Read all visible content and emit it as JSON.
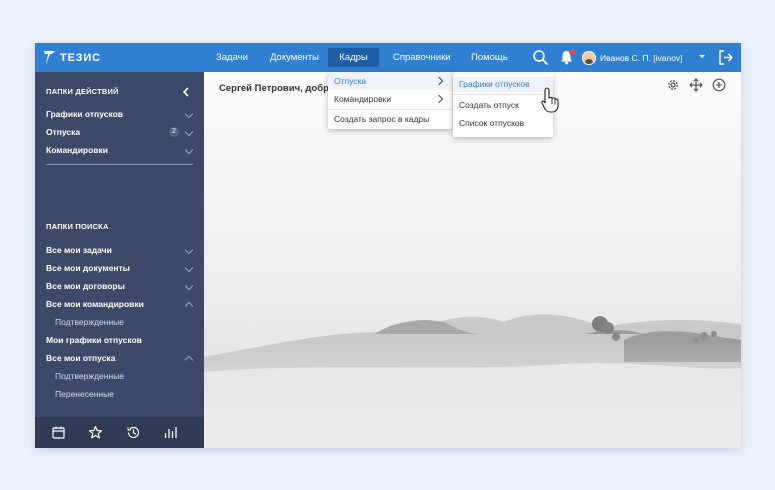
{
  "app": {
    "logo_text": "ТЕЗИС"
  },
  "nav": {
    "items": [
      {
        "label": "Задачи"
      },
      {
        "label": "Документы"
      },
      {
        "label": "Кадры",
        "active": true
      },
      {
        "label": "Справочники"
      },
      {
        "label": "Помощь"
      }
    ]
  },
  "user": {
    "name": "Иванов С. П. [ivanov]"
  },
  "sidebar": {
    "actions_heading": "ПАПКИ ДЕЙСТВИЙ",
    "action_items": [
      {
        "label": "Графики отпусков"
      },
      {
        "label": "Отпуска",
        "count": "2"
      },
      {
        "label": "Командировки"
      }
    ],
    "search_heading": "ПАПКИ ПОИСКА",
    "search_items": [
      {
        "label": "Все мои задачи"
      },
      {
        "label": "Все мои документы"
      },
      {
        "label": "Все мои договоры"
      },
      {
        "label": "Все мои командировки"
      },
      {
        "label": "Подтвержденные"
      },
      {
        "label": "Мои графики отпусков"
      },
      {
        "label": "Все мои отпуска"
      },
      {
        "label": "Подтвержденные"
      },
      {
        "label": "Перенесенные"
      }
    ]
  },
  "main": {
    "welcome": "Сергей Петрович, добро"
  },
  "menu_kadry": {
    "items": [
      {
        "label": "Отпуска"
      },
      {
        "label": "Командировки"
      },
      {
        "label": "Создать запрос в кадры"
      }
    ]
  },
  "menu_otpuska": {
    "items": [
      {
        "label": "Графики отпусков"
      },
      {
        "label": "Создать отпуск"
      },
      {
        "label": "Список отпусков"
      }
    ]
  },
  "colors": {
    "topbar": "#2f7fd3",
    "topbar_active": "#1f5ea6",
    "sidebar": "#3c4a69",
    "sidebar_bottom": "#2f3a55",
    "notification": "#e84a4a"
  },
  "icons": [
    "logo-icon",
    "search-icon",
    "bell-icon",
    "logout-icon",
    "chevron-left-icon",
    "calendar-icon",
    "star-icon",
    "history-icon",
    "chart-icon",
    "gear-icon",
    "move-icon",
    "add-icon",
    "hand-cursor-icon"
  ]
}
